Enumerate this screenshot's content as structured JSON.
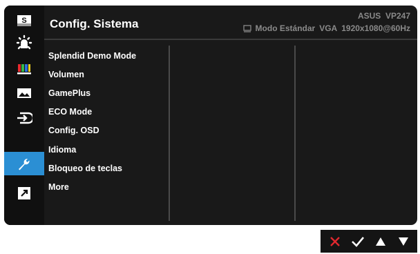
{
  "header": {
    "title": "Config. Sistema",
    "model": "ASUS  VP247",
    "status": {
      "icon": "monitor-icon",
      "mode": "Modo Estándar",
      "input": "VGA",
      "resolution": "1920x1080@60Hz"
    }
  },
  "sidebar": {
    "items": [
      {
        "icon": "splendid-s-icon",
        "active": false
      },
      {
        "icon": "brightness-icon",
        "active": false
      },
      {
        "icon": "color-bars-icon",
        "active": false
      },
      {
        "icon": "image-icon",
        "active": false
      },
      {
        "icon": "input-select-icon",
        "active": false
      },
      {
        "icon": "wrench-icon",
        "active": true
      },
      {
        "icon": "shortcut-arrow-icon",
        "active": false
      }
    ]
  },
  "menu": {
    "items": [
      "Splendid Demo Mode",
      "Volumen",
      "GamePlus",
      "ECO Mode",
      "Config. OSD",
      "Idioma",
      "Bloqueo de teclas",
      "More"
    ]
  },
  "nav": {
    "buttons": [
      {
        "icon": "close-icon"
      },
      {
        "icon": "check-icon"
      },
      {
        "icon": "arrow-up-icon"
      },
      {
        "icon": "arrow-down-icon"
      }
    ]
  },
  "colors": {
    "accent": "#2b8fd4",
    "close": "#e0282e",
    "background": "#191919"
  }
}
